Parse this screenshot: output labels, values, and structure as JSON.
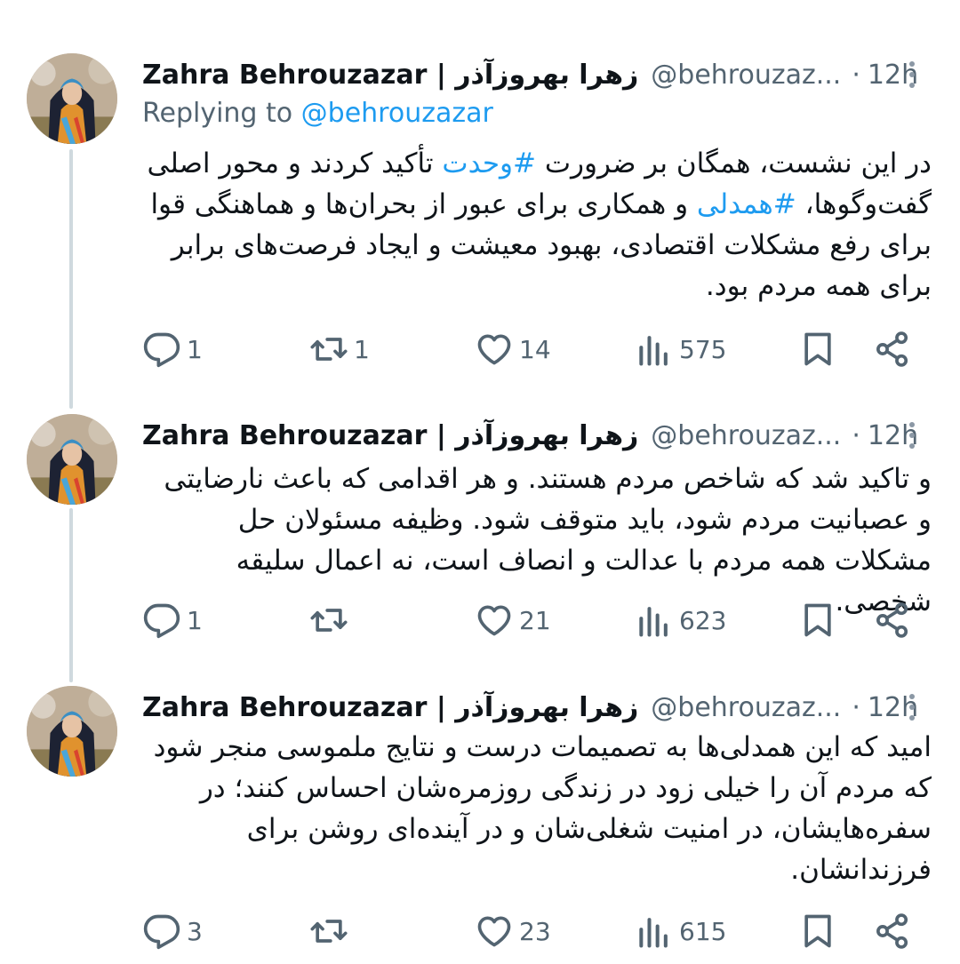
{
  "tweets": [
    {
      "name": "Zahra Behrouzazar | زهرا بهروزآذر",
      "handle": "@behrouzaz...",
      "dot": "·",
      "time": "12h",
      "replying_prefix": "Replying to ",
      "replying_to": "@behrouzazar",
      "text_part1": "در این نشست، همگان بر ضرورت ",
      "hashtag1": "#وحدت",
      "text_part2": " تأکید کردند و محور اصلی گفت‌وگوها، ",
      "hashtag2": "#همدلی",
      "text_part3": " و همکاری برای عبور از بحران‌ها و هماهنگی قوا برای رفع مشکلات اقتصادی، بهبود معیشت و ایجاد فرصت‌های برابر برای همه مردم بود.",
      "replies": "1",
      "reposts": "1",
      "likes": "14",
      "views": "575"
    },
    {
      "name": "Zahra Behrouzazar | زهرا بهروزآذر",
      "handle": "@behrouzaz...",
      "dot": "·",
      "time": "12h",
      "text": "و تاکید شد که شاخص مردم هستند. و هر اقدامی که باعث نارضایتی و عصبانیت مردم شود، باید متوقف شود. وظیفه مسئولان حل مشکلات همه مردم با عدالت و انصاف است، نه اعمال سلیقه شخصی.",
      "replies": "1",
      "reposts": "",
      "likes": "21",
      "views": "623"
    },
    {
      "name": "Zahra Behrouzazar | زهرا بهروزآذر",
      "handle": "@behrouzaz...",
      "dot": "·",
      "time": "12h",
      "text": "امید  که این همدلی‌ها به تصمیمات درست و نتایج ملموسی منجر شود که مردم آن را خیلی زود  در زندگی روزمره‌شان احساس کنند؛ در سفره‌هایشان، در امنیت شغلی‌شان و در آینده‌ای روشن برای فرزندانشان.",
      "replies": "3",
      "reposts": "",
      "likes": "23",
      "views": "615"
    }
  ],
  "icons": {
    "reply": "reply-icon",
    "repost": "repost-icon",
    "like": "heart-icon",
    "views": "views-icon",
    "bookmark": "bookmark-icon",
    "share": "share-icon",
    "more": "more-icon"
  },
  "colors": {
    "link": "#1d9bf0",
    "secondary_text": "#536471",
    "thread_line": "#cfd9de"
  }
}
